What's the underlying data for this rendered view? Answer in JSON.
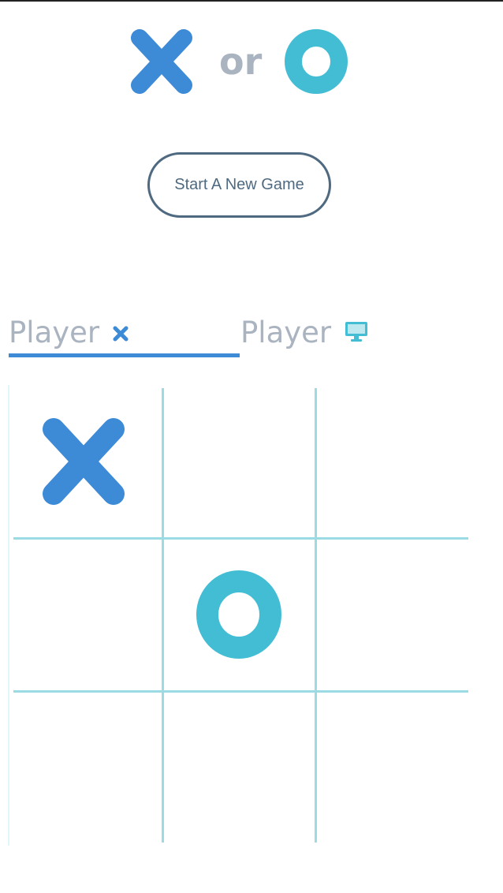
{
  "logo": {
    "x_icon": "x-mark-icon",
    "separator": "or",
    "o_icon": "o-ring-icon"
  },
  "start_button": {
    "label": "Start A New Game"
  },
  "players": [
    {
      "label": "Player",
      "icon": "x-mark-icon",
      "active": true
    },
    {
      "label": "Player",
      "icon": "computer-monitor-icon",
      "active": false
    }
  ],
  "board": {
    "cells": [
      "X",
      "",
      "",
      "",
      "O",
      "",
      "",
      "",
      ""
    ]
  },
  "colors": {
    "x_mark": "#3d8ad6",
    "o_mark": "#42bdd4",
    "grid": "#9ddbe4",
    "muted_text": "#aab3c0",
    "button_border": "#4f6a80",
    "active_underline": "#3d8ad6"
  }
}
